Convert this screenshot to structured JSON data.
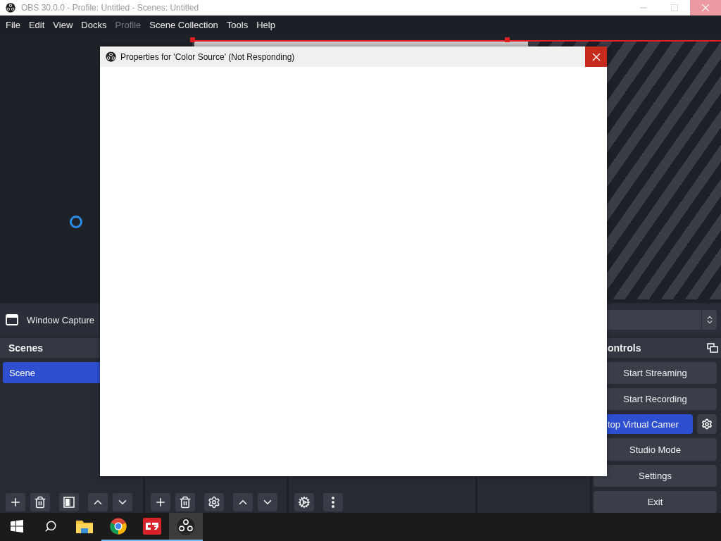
{
  "window": {
    "title": "OBS 30.0.0 - Profile: Untitled - Scenes: Untitled"
  },
  "menu": [
    {
      "label": "File",
      "disabled": false
    },
    {
      "label": "Edit",
      "disabled": false
    },
    {
      "label": "View",
      "disabled": false
    },
    {
      "label": "Docks",
      "disabled": false
    },
    {
      "label": "Profile",
      "disabled": true
    },
    {
      "label": "Scene Collection",
      "disabled": false
    },
    {
      "label": "Tools",
      "disabled": false
    },
    {
      "label": "Help",
      "disabled": false
    }
  ],
  "dialog": {
    "title": "Properties for 'Color Source' (Not Responding)"
  },
  "source_toolbar": {
    "source": "Window Capture"
  },
  "scenes": {
    "title": "Scenes",
    "items": [
      {
        "label": "Scene",
        "selected": true
      }
    ]
  },
  "controls": {
    "title": "ontrols",
    "buttons": [
      {
        "label": "Start Streaming",
        "kind": "plain",
        "active": false
      },
      {
        "label": "Start Recording",
        "kind": "plain",
        "active": false
      },
      {
        "label": "top Virtual Camer",
        "kind": "with_settings",
        "active": true
      },
      {
        "label": "Studio Mode",
        "kind": "plain",
        "active": false
      },
      {
        "label": "Settings",
        "kind": "plain",
        "active": false
      },
      {
        "label": "Exit",
        "kind": "plain",
        "active": false
      }
    ]
  },
  "taskbar": {
    "apps": [
      {
        "kind": "folder",
        "running": false,
        "active": false
      },
      {
        "kind": "browser",
        "running": true,
        "active": false
      },
      {
        "kind": "cvr",
        "running": true,
        "active": false
      },
      {
        "kind": "obs",
        "running": true,
        "active": true
      }
    ]
  }
}
